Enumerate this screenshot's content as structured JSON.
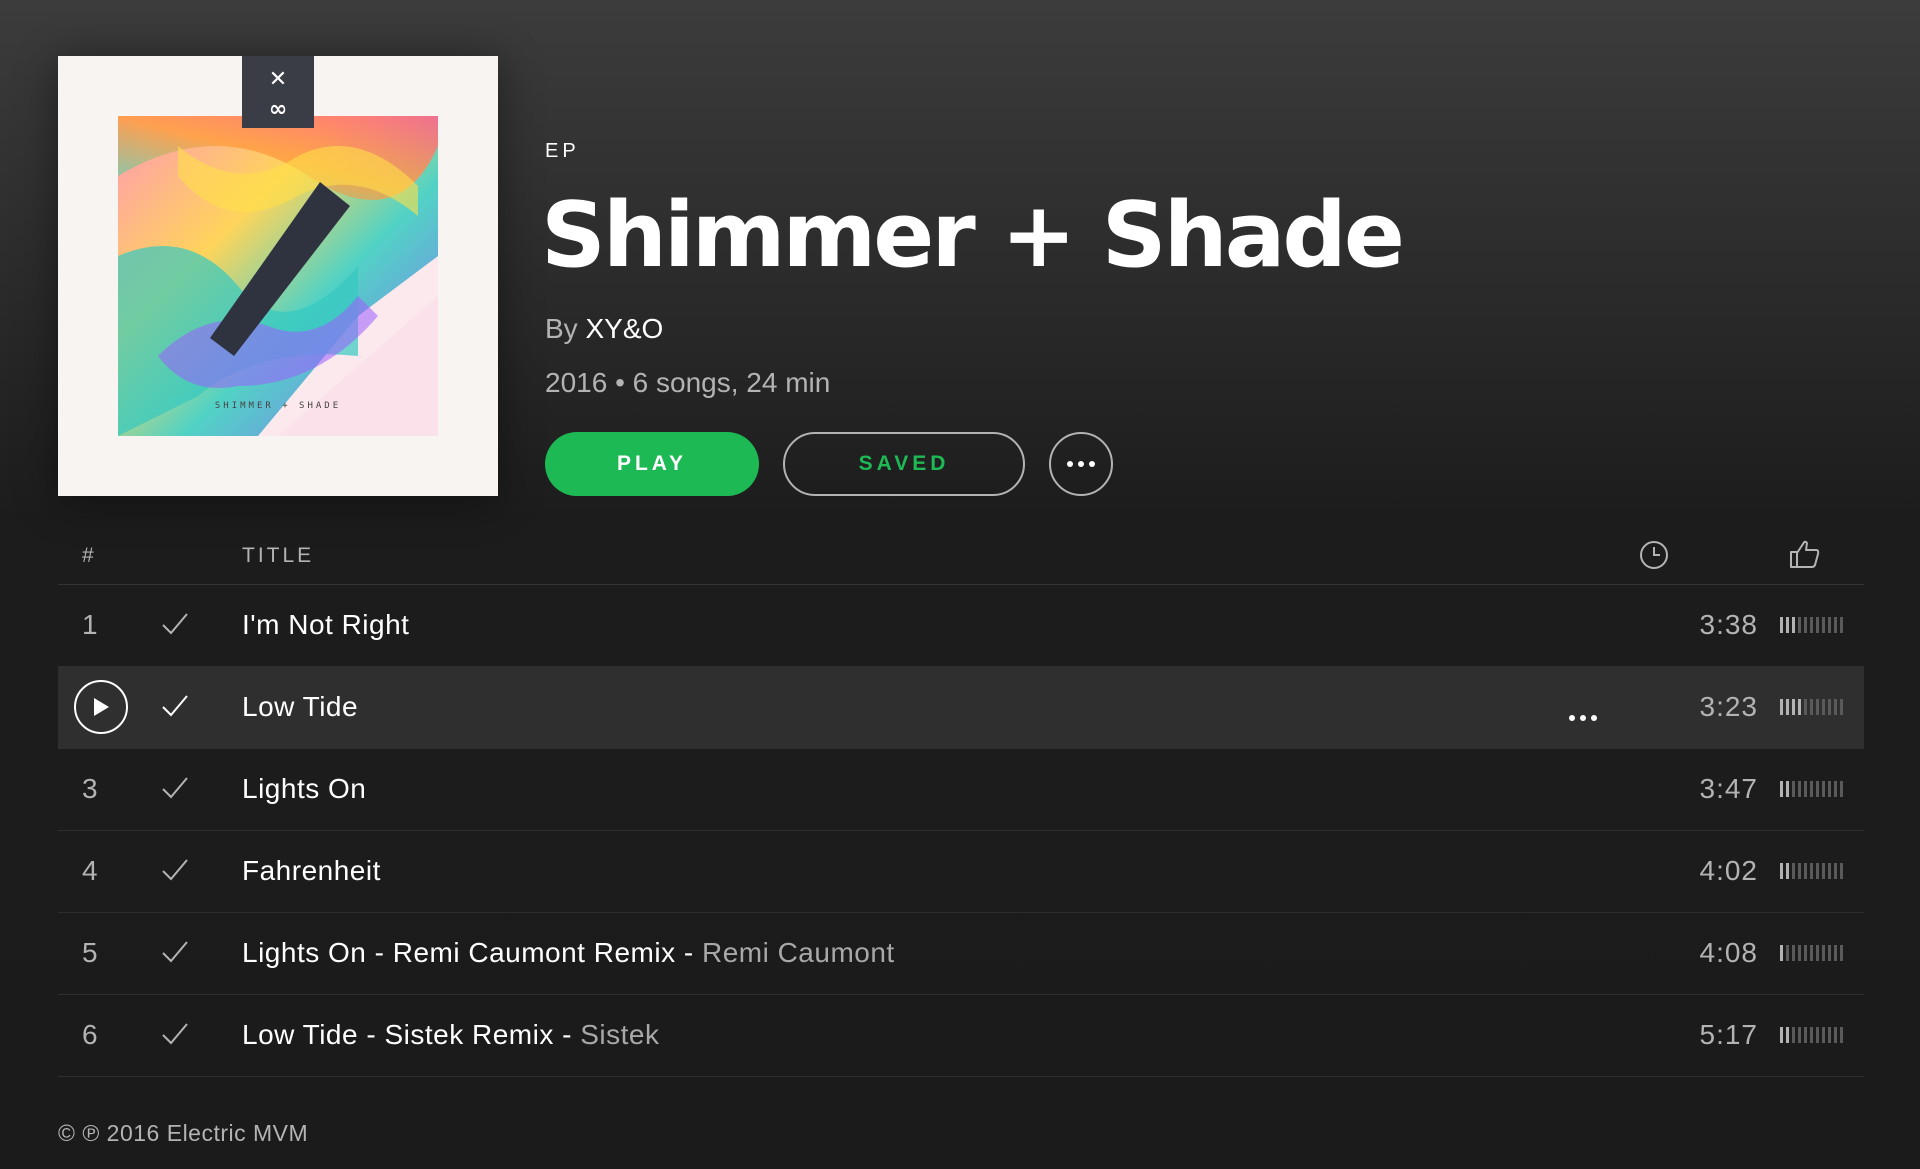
{
  "album": {
    "type": "EP",
    "title": "Shimmer + Shade",
    "by_label": "By",
    "artist": "XY&O",
    "meta": "2016 • 6 songs, 24 min",
    "cover": {
      "text": "SHIMMER  +  SHADE",
      "logo": "XY&O"
    }
  },
  "actions": {
    "play_label": "PLAY",
    "saved_label": "SAVED",
    "more_icon": "more-horizontal-icon"
  },
  "tracklist": {
    "header": {
      "number": "#",
      "title": "TITLE",
      "duration_icon": "clock-icon",
      "popularity_icon": "thumbs-up-icon"
    },
    "tracks": [
      {
        "number": "1",
        "title": "I'm Not Right",
        "featuring": "",
        "duration": "3:38",
        "saved": true,
        "popularity": 3,
        "active": false
      },
      {
        "number": "2",
        "title": "Low Tide",
        "featuring": "",
        "duration": "3:23",
        "saved": true,
        "popularity": 4,
        "active": true
      },
      {
        "number": "3",
        "title": "Lights On",
        "featuring": "",
        "duration": "3:47",
        "saved": true,
        "popularity": 2,
        "active": false
      },
      {
        "number": "4",
        "title": "Fahrenheit",
        "featuring": "",
        "duration": "4:02",
        "saved": true,
        "popularity": 2,
        "active": false
      },
      {
        "number": "5",
        "title": "Lights On - Remi Caumont Remix - ",
        "featuring": "Remi Caumont",
        "duration": "4:08",
        "saved": true,
        "popularity": 1,
        "active": false
      },
      {
        "number": "6",
        "title": "Low Tide - Sistek Remix - ",
        "featuring": "Sistek",
        "duration": "5:17",
        "saved": true,
        "popularity": 2,
        "active": false
      }
    ]
  },
  "copyright": "© ℗ 2016 Electric MVM",
  "colors": {
    "accent": "#1db954",
    "text_secondary": "#b3b3b3",
    "active_row": "#2f2f2f"
  }
}
